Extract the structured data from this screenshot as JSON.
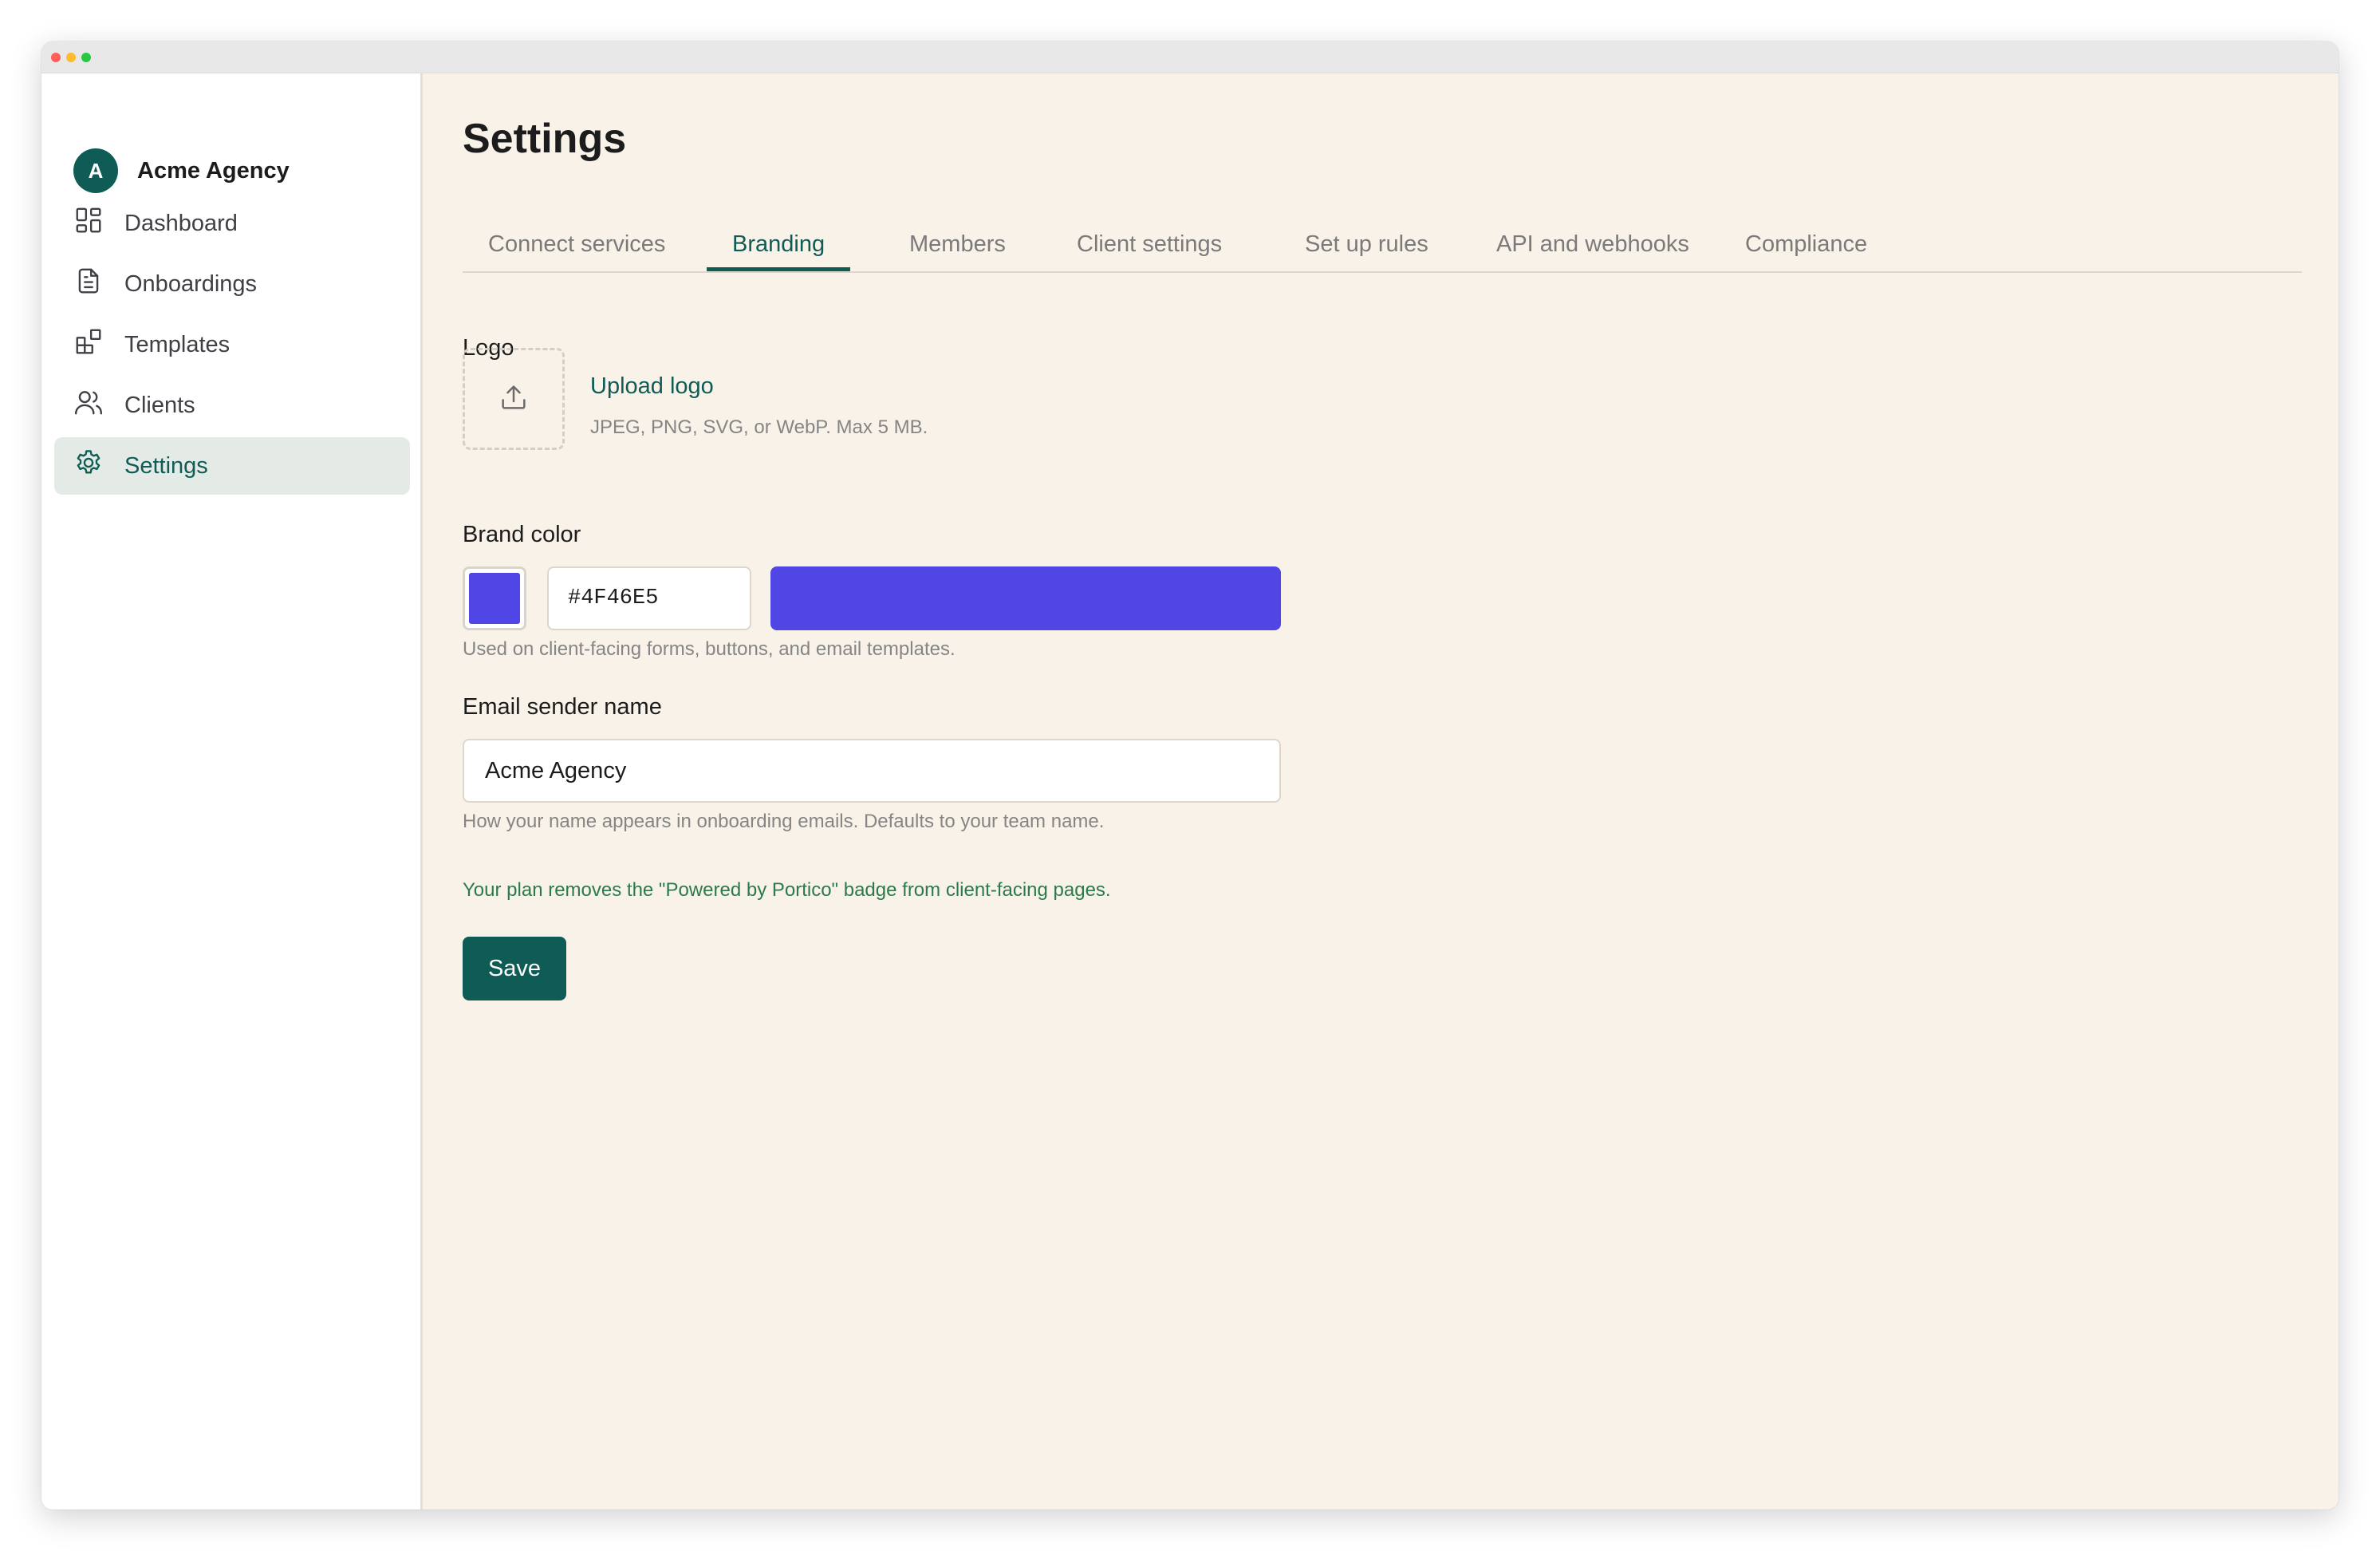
{
  "window": {
    "controls": [
      {
        "name": "close",
        "color": "#ff5f57"
      },
      {
        "name": "minimize",
        "color": "#febc2e"
      },
      {
        "name": "maximize",
        "color": "#28c840"
      }
    ]
  },
  "sidebar": {
    "brand": {
      "initial": "A",
      "name": "Acme Agency"
    },
    "items": [
      {
        "label": "Dashboard",
        "icon": "dashboard-icon",
        "active": false
      },
      {
        "label": "Onboardings",
        "icon": "document-icon",
        "active": false
      },
      {
        "label": "Templates",
        "icon": "templates-icon",
        "active": false
      },
      {
        "label": "Clients",
        "icon": "users-icon",
        "active": false
      },
      {
        "label": "Settings",
        "icon": "gear-icon",
        "active": true
      }
    ]
  },
  "main": {
    "title": "Settings",
    "tabs": [
      {
        "label": "Connect services",
        "active": false
      },
      {
        "label": "Branding",
        "active": true
      },
      {
        "label": "Members",
        "active": false
      },
      {
        "label": "Client settings",
        "active": false
      },
      {
        "label": "Set up rules",
        "active": false
      },
      {
        "label": "API and webhooks",
        "active": false
      },
      {
        "label": "Compliance",
        "active": false
      }
    ],
    "logo": {
      "label": "Logo",
      "upload_label": "Upload logo",
      "hint": "JPEG, PNG, SVG, or WebP. Max 5 MB.",
      "icon": "upload-icon"
    },
    "brand_color": {
      "label": "Brand color",
      "value": "#4F46E5",
      "hint": "Used on client-facing forms, buttons, and email templates."
    },
    "email_sender": {
      "label": "Email sender name",
      "value": "Acme Agency",
      "hint": "How your name appears in onboarding emails. Defaults to your team name."
    },
    "plan_note": "Your plan removes the \"Powered by Portico\" badge from client-facing pages.",
    "save_label": "Save"
  },
  "colors": {
    "accent": "#0F5C57",
    "background": "#F8F2E8",
    "success_text": "#2C7A4B"
  }
}
